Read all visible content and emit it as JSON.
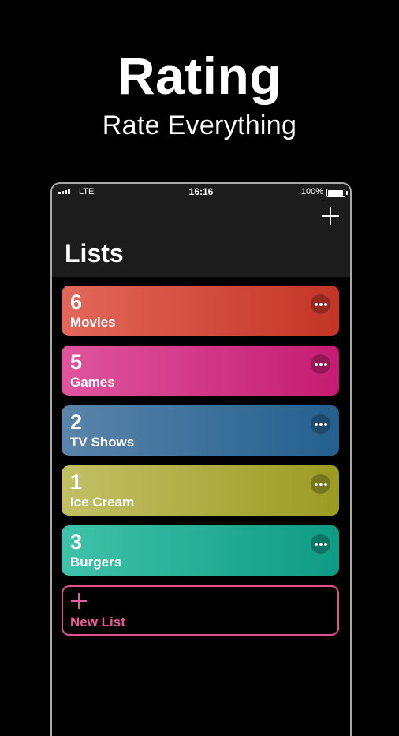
{
  "promo": {
    "title": "Rating",
    "subtitle": "Rate Everything"
  },
  "status_bar": {
    "carrier": "LTE",
    "time": "16:16",
    "battery": "100%"
  },
  "nav": {
    "title": "Lists",
    "add_icon": "plus-icon"
  },
  "lists": [
    {
      "count": "6",
      "name": "Movies",
      "colors": [
        "#e2675a",
        "#c43526"
      ]
    },
    {
      "count": "5",
      "name": "Games",
      "colors": [
        "#e0559d",
        "#c41c72"
      ]
    },
    {
      "count": "2",
      "name": "TV Shows",
      "colors": [
        "#5a84aa",
        "#23608f"
      ]
    },
    {
      "count": "1",
      "name": "Ice Cream",
      "colors": [
        "#c2c065",
        "#9b9b22"
      ]
    },
    {
      "count": "3",
      "name": "Burgers",
      "colors": [
        "#3fc2a8",
        "#0e9b84"
      ]
    }
  ],
  "new_list": {
    "label": "New List",
    "accent": "#e2508e"
  }
}
